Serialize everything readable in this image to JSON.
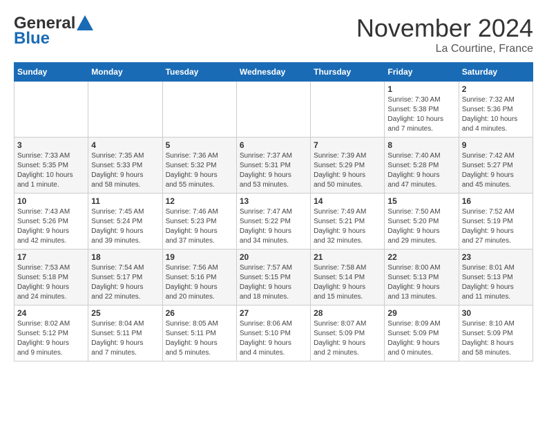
{
  "logo": {
    "line1": "General",
    "line2": "Blue"
  },
  "title": {
    "month_year": "November 2024",
    "location": "La Courtine, France"
  },
  "weekdays": [
    "Sunday",
    "Monday",
    "Tuesday",
    "Wednesday",
    "Thursday",
    "Friday",
    "Saturday"
  ],
  "weeks": [
    [
      {
        "day": "",
        "info": ""
      },
      {
        "day": "",
        "info": ""
      },
      {
        "day": "",
        "info": ""
      },
      {
        "day": "",
        "info": ""
      },
      {
        "day": "",
        "info": ""
      },
      {
        "day": "1",
        "info": "Sunrise: 7:30 AM\nSunset: 5:38 PM\nDaylight: 10 hours\nand 7 minutes."
      },
      {
        "day": "2",
        "info": "Sunrise: 7:32 AM\nSunset: 5:36 PM\nDaylight: 10 hours\nand 4 minutes."
      }
    ],
    [
      {
        "day": "3",
        "info": "Sunrise: 7:33 AM\nSunset: 5:35 PM\nDaylight: 10 hours\nand 1 minute."
      },
      {
        "day": "4",
        "info": "Sunrise: 7:35 AM\nSunset: 5:33 PM\nDaylight: 9 hours\nand 58 minutes."
      },
      {
        "day": "5",
        "info": "Sunrise: 7:36 AM\nSunset: 5:32 PM\nDaylight: 9 hours\nand 55 minutes."
      },
      {
        "day": "6",
        "info": "Sunrise: 7:37 AM\nSunset: 5:31 PM\nDaylight: 9 hours\nand 53 minutes."
      },
      {
        "day": "7",
        "info": "Sunrise: 7:39 AM\nSunset: 5:29 PM\nDaylight: 9 hours\nand 50 minutes."
      },
      {
        "day": "8",
        "info": "Sunrise: 7:40 AM\nSunset: 5:28 PM\nDaylight: 9 hours\nand 47 minutes."
      },
      {
        "day": "9",
        "info": "Sunrise: 7:42 AM\nSunset: 5:27 PM\nDaylight: 9 hours\nand 45 minutes."
      }
    ],
    [
      {
        "day": "10",
        "info": "Sunrise: 7:43 AM\nSunset: 5:26 PM\nDaylight: 9 hours\nand 42 minutes."
      },
      {
        "day": "11",
        "info": "Sunrise: 7:45 AM\nSunset: 5:24 PM\nDaylight: 9 hours\nand 39 minutes."
      },
      {
        "day": "12",
        "info": "Sunrise: 7:46 AM\nSunset: 5:23 PM\nDaylight: 9 hours\nand 37 minutes."
      },
      {
        "day": "13",
        "info": "Sunrise: 7:47 AM\nSunset: 5:22 PM\nDaylight: 9 hours\nand 34 minutes."
      },
      {
        "day": "14",
        "info": "Sunrise: 7:49 AM\nSunset: 5:21 PM\nDaylight: 9 hours\nand 32 minutes."
      },
      {
        "day": "15",
        "info": "Sunrise: 7:50 AM\nSunset: 5:20 PM\nDaylight: 9 hours\nand 29 minutes."
      },
      {
        "day": "16",
        "info": "Sunrise: 7:52 AM\nSunset: 5:19 PM\nDaylight: 9 hours\nand 27 minutes."
      }
    ],
    [
      {
        "day": "17",
        "info": "Sunrise: 7:53 AM\nSunset: 5:18 PM\nDaylight: 9 hours\nand 24 minutes."
      },
      {
        "day": "18",
        "info": "Sunrise: 7:54 AM\nSunset: 5:17 PM\nDaylight: 9 hours\nand 22 minutes."
      },
      {
        "day": "19",
        "info": "Sunrise: 7:56 AM\nSunset: 5:16 PM\nDaylight: 9 hours\nand 20 minutes."
      },
      {
        "day": "20",
        "info": "Sunrise: 7:57 AM\nSunset: 5:15 PM\nDaylight: 9 hours\nand 18 minutes."
      },
      {
        "day": "21",
        "info": "Sunrise: 7:58 AM\nSunset: 5:14 PM\nDaylight: 9 hours\nand 15 minutes."
      },
      {
        "day": "22",
        "info": "Sunrise: 8:00 AM\nSunset: 5:13 PM\nDaylight: 9 hours\nand 13 minutes."
      },
      {
        "day": "23",
        "info": "Sunrise: 8:01 AM\nSunset: 5:13 PM\nDaylight: 9 hours\nand 11 minutes."
      }
    ],
    [
      {
        "day": "24",
        "info": "Sunrise: 8:02 AM\nSunset: 5:12 PM\nDaylight: 9 hours\nand 9 minutes."
      },
      {
        "day": "25",
        "info": "Sunrise: 8:04 AM\nSunset: 5:11 PM\nDaylight: 9 hours\nand 7 minutes."
      },
      {
        "day": "26",
        "info": "Sunrise: 8:05 AM\nSunset: 5:11 PM\nDaylight: 9 hours\nand 5 minutes."
      },
      {
        "day": "27",
        "info": "Sunrise: 8:06 AM\nSunset: 5:10 PM\nDaylight: 9 hours\nand 4 minutes."
      },
      {
        "day": "28",
        "info": "Sunrise: 8:07 AM\nSunset: 5:09 PM\nDaylight: 9 hours\nand 2 minutes."
      },
      {
        "day": "29",
        "info": "Sunrise: 8:09 AM\nSunset: 5:09 PM\nDaylight: 9 hours\nand 0 minutes."
      },
      {
        "day": "30",
        "info": "Sunrise: 8:10 AM\nSunset: 5:09 PM\nDaylight: 8 hours\nand 58 minutes."
      }
    ]
  ]
}
